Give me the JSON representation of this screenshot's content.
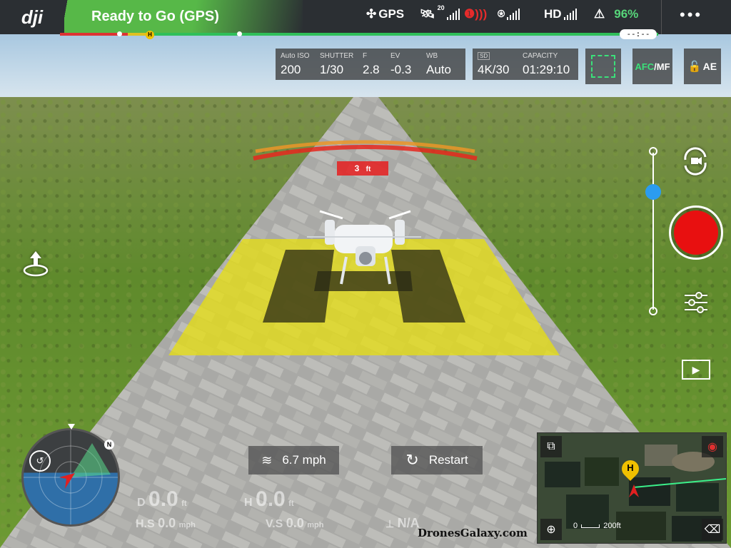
{
  "app": {
    "logo": "dji"
  },
  "status": {
    "text": "Ready to Go (GPS)",
    "color": "#57b848"
  },
  "topbar": {
    "gps_label": "GPS",
    "satellite_count": "20",
    "hd_label": "HD",
    "battery": "96%",
    "battery_color": "#57d67a",
    "flight_time": "--:--",
    "home_marker": "H"
  },
  "camera": {
    "iso_label": "Auto ISO",
    "iso_value": "200",
    "shutter_label": "SHUTTER",
    "shutter_value": "1/30",
    "f_label": "F",
    "f_value": "2.8",
    "ev_label": "EV",
    "ev_value": "-0.3",
    "wb_label": "WB",
    "wb_value": "Auto",
    "sd_label": "SD",
    "resolution": "4K/30",
    "capacity_label": "CAPACITY",
    "capacity_value": "01:29:10",
    "focus_mode_afc": "AFC",
    "focus_mode_mf": "/MF",
    "ae_label": "AE"
  },
  "obstacle": {
    "distance_value": "3",
    "distance_unit": "ft"
  },
  "wind": {
    "speed": "6.7 mph"
  },
  "restart": {
    "label": "Restart"
  },
  "telemetry": {
    "d_label": "D",
    "d_value": "0.0",
    "d_unit": "ft",
    "h_label": "H",
    "h_value": "0.0",
    "h_unit": "ft",
    "hs_label": "H.S",
    "hs_value": "0.0",
    "hs_unit": "mph",
    "vs_label": "V.S",
    "vs_value": "0.0",
    "vs_unit": "mph",
    "vps_value": "N/A"
  },
  "compass": {
    "north": "N"
  },
  "map": {
    "scale_start": "0",
    "scale_end": "200ft",
    "home": "H"
  },
  "watermark": "DronesGalaxy.com",
  "colors": {
    "record": "#e81010",
    "accent_green": "#2fbf5a",
    "focus_green": "#3be07a"
  }
}
